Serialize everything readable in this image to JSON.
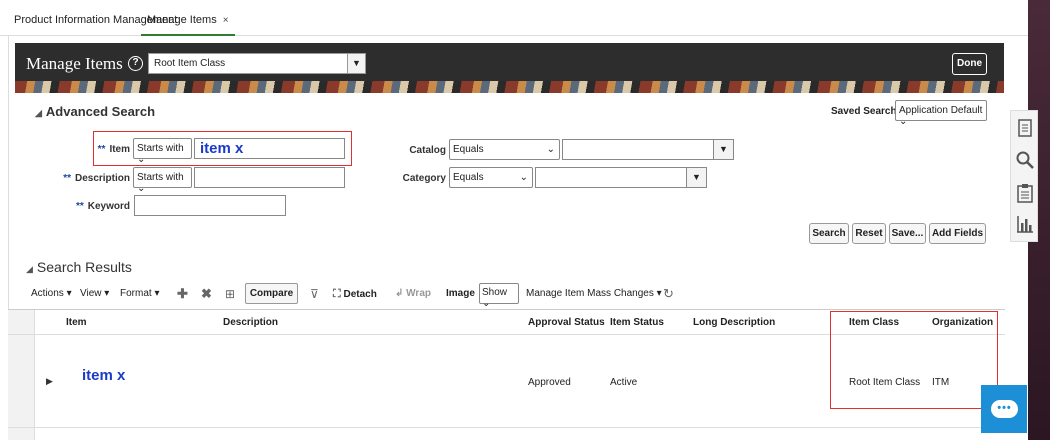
{
  "tabs": {
    "pim": "Product Information Management",
    "manage_items": "Manage Items",
    "close": "×"
  },
  "header": {
    "title": "Manage Items",
    "help": "?",
    "item_class": "Root Item Class",
    "done": "Done"
  },
  "advanced_search": {
    "title": "Advanced Search",
    "saved_search_label": "Saved Search",
    "saved_search_value": "Application Default",
    "required_marker": "**",
    "item_label": "Item",
    "item_operator": "Starts with",
    "item_value": "item x",
    "description_label": "Description",
    "description_operator": "Starts with",
    "description_value": "",
    "keyword_label": "Keyword",
    "keyword_value": "",
    "catalog_label": "Catalog",
    "catalog_operator": "Equals",
    "catalog_value": "",
    "category_label": "Category",
    "category_operator": "Equals",
    "category_value": "",
    "buttons": {
      "search": "Search",
      "reset": "Reset",
      "save": "Save...",
      "add_fields": "Add Fields"
    }
  },
  "search_results": {
    "title": "Search Results",
    "toolbar": {
      "actions": "Actions",
      "view": "View",
      "format": "Format",
      "compare": "Compare",
      "detach": "Detach",
      "wrap": "Wrap",
      "image_label": "Image",
      "image_value": "Show",
      "mass_changes": "Manage Item Mass Changes"
    },
    "columns": {
      "item": "Item",
      "description": "Description",
      "approval_status": "Approval Status",
      "item_status": "Item Status",
      "long_description": "Long Description",
      "item_class": "Item Class",
      "organization": "Organization"
    },
    "rows": [
      {
        "item": "item x",
        "description": "",
        "approval_status": "Approved",
        "item_status": "Active",
        "long_description": "",
        "item_class": "Root Item Class",
        "organization": "ITM"
      }
    ]
  },
  "colors": {
    "accent_blue": "#1a3ac9",
    "highlight_red": "#e03030",
    "tab_underline": "#2e7d32",
    "chat_blue": "#1d8fd6"
  },
  "icons": {
    "side_panel": [
      "document-icon",
      "search-icon",
      "clipboard-icon",
      "bar-chart-icon"
    ],
    "chat": "chat-icon"
  }
}
